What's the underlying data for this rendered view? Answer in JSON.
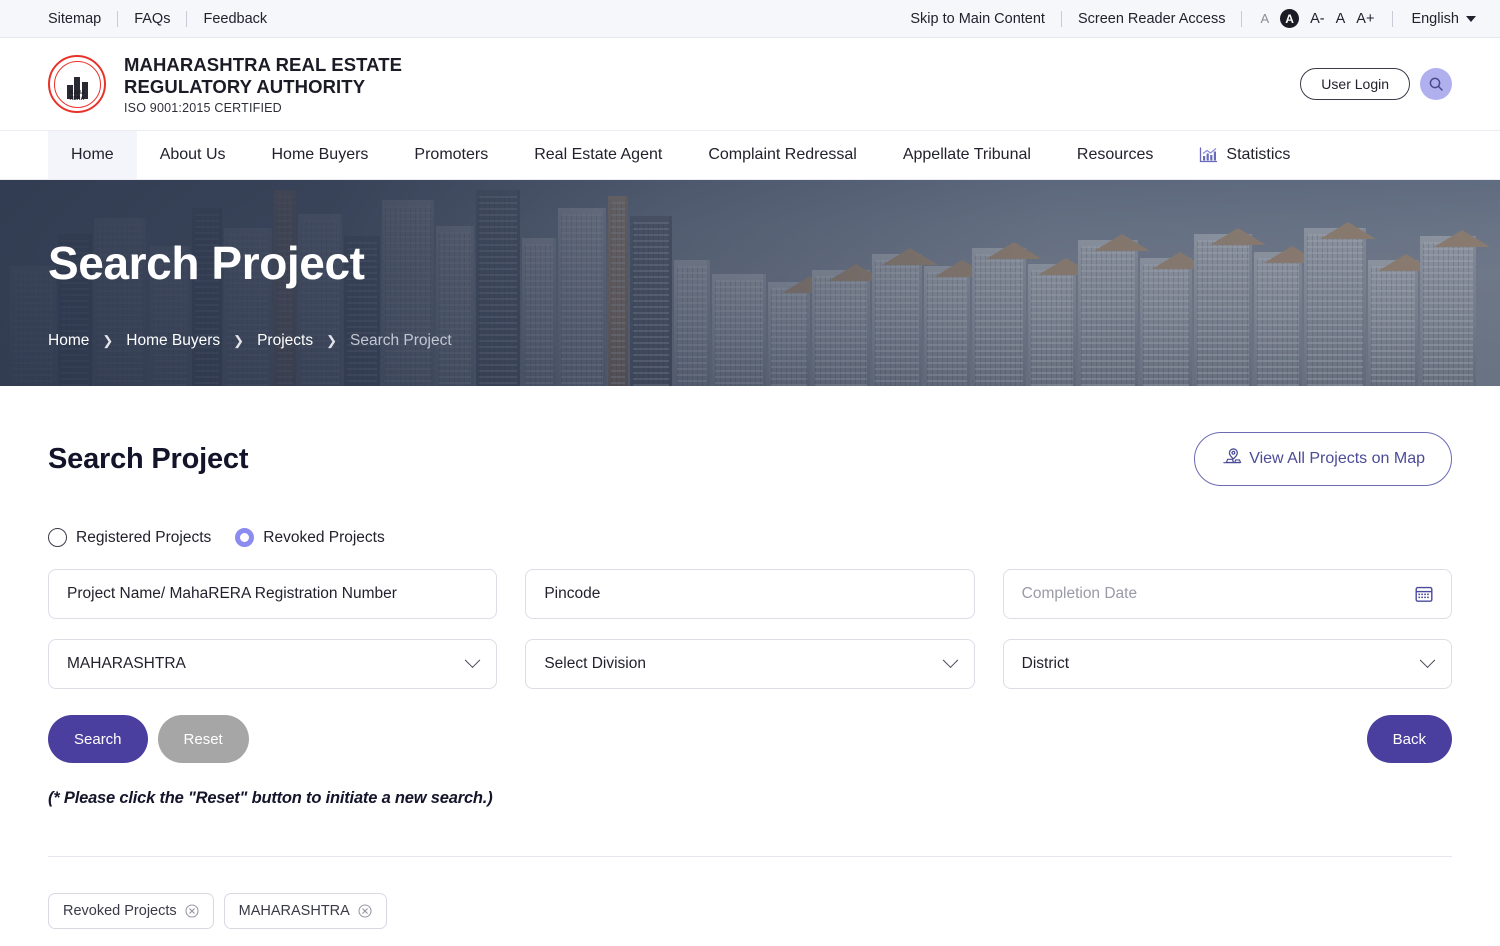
{
  "topbar": {
    "left_links": [
      "Sitemap",
      "FAQs",
      "Feedback"
    ],
    "skip_link": "Skip to Main Content",
    "screen_reader": "Screen Reader Access",
    "font_small": "A",
    "font_contrast": "A",
    "font_decrease": "A-",
    "font_normal": "A",
    "font_increase": "A+",
    "language": "English"
  },
  "header": {
    "title_line1": "MAHARASHTRA REAL ESTATE",
    "title_line2": "REGULATORY AUTHORITY",
    "subtitle": "ISO 9001:2015 CERTIFIED",
    "logo_text_top": "MAHA",
    "logo_text_bottom": "RERA",
    "user_login": "User Login"
  },
  "nav": {
    "items": [
      {
        "label": "Home",
        "active": true
      },
      {
        "label": "About Us",
        "active": false
      },
      {
        "label": "Home Buyers",
        "active": false
      },
      {
        "label": "Promoters",
        "active": false
      },
      {
        "label": "Real Estate Agent",
        "active": false
      },
      {
        "label": "Complaint Redressal",
        "active": false
      },
      {
        "label": "Appellate Tribunal",
        "active": false
      },
      {
        "label": "Resources",
        "active": false
      },
      {
        "label": "Statistics",
        "active": false
      }
    ]
  },
  "hero": {
    "title": "Search Project",
    "breadcrumb": [
      "Home",
      "Home Buyers",
      "Projects",
      "Search Project"
    ],
    "separator": "❯"
  },
  "main": {
    "page_title": "Search Project",
    "map_button": "View All Projects on Map",
    "radios": [
      {
        "label": "Registered Projects",
        "checked": false
      },
      {
        "label": "Revoked Projects",
        "checked": true
      }
    ],
    "fields": {
      "project_name": {
        "placeholder": "Project Name/ MahaRERA Registration Number",
        "value": ""
      },
      "pincode": {
        "placeholder": "Pincode",
        "value": ""
      },
      "completion_date": {
        "placeholder": "Completion Date",
        "value": ""
      },
      "state": {
        "value": "MAHARASHTRA"
      },
      "division": {
        "value": "Select Division"
      },
      "district": {
        "value": "District"
      }
    },
    "buttons": {
      "search": "Search",
      "reset": "Reset",
      "back": "Back"
    },
    "note": "(* Please click the \"Reset\" button to initiate a new search.)",
    "chips": [
      "Revoked Projects",
      "MAHARASHTRA"
    ]
  },
  "colors": {
    "accent_purple": "#4a3f9e",
    "light_purple": "#8c8cf0",
    "reset_gray": "#a6a6a6",
    "logo_red": "#e8332a",
    "hero_overlay": "#2c364c"
  }
}
